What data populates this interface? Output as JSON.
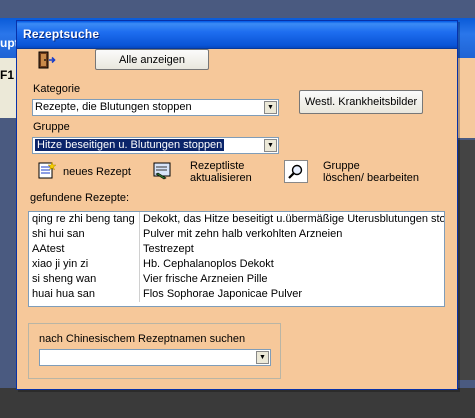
{
  "background": {
    "parent_fragment": "upt",
    "parent_label": "F1"
  },
  "dialog": {
    "title": "Rezeptsuche",
    "exit_icon": "exit-door-icon",
    "show_all_label": "Alle anzeigen",
    "category_label": "Kategorie",
    "category_value": "Rezepte, die Blutungen stoppen",
    "western_button_label": "Westl. Krankheitsbilder",
    "group_label": "Gruppe",
    "group_value": "Hitze beseitigen u. Blutungen stoppen",
    "new_recipe_label": "neues Rezept",
    "refresh_label_line1": "Rezeptliste",
    "refresh_label_line2": "aktualisieren",
    "group_edit_label_line1": "Gruppe",
    "group_edit_label_line2": "löschen/ bearbeiten",
    "found_label": "gefundene Rezepte:",
    "recipes": [
      {
        "name": "qing re zhi beng tang",
        "description": "Dekokt, das Hitze beseitigt u.übermäßige Uterusblutungen stop"
      },
      {
        "name": "shi hui san",
        "description": "Pulver mit zehn halb verkohlten Arzneien"
      },
      {
        "name": "AAtest",
        "description": "Testrezept"
      },
      {
        "name": "xiao ji yin zi",
        "description": "Hb. Cephalanoplos Dekokt"
      },
      {
        "name": "si sheng wan",
        "description": "Vier frische Arzneien Pille"
      },
      {
        "name": "huai hua san",
        "description": "Flos Sophorae Japonicae Pulver"
      }
    ],
    "chinese_search_label": "nach Chinesischem Rezeptnamen suchen",
    "chinese_search_value": ""
  },
  "colors": {
    "dialog_bg": "#f6c89a",
    "titlebar": "#0a54d6",
    "selection": "#0a246a"
  }
}
